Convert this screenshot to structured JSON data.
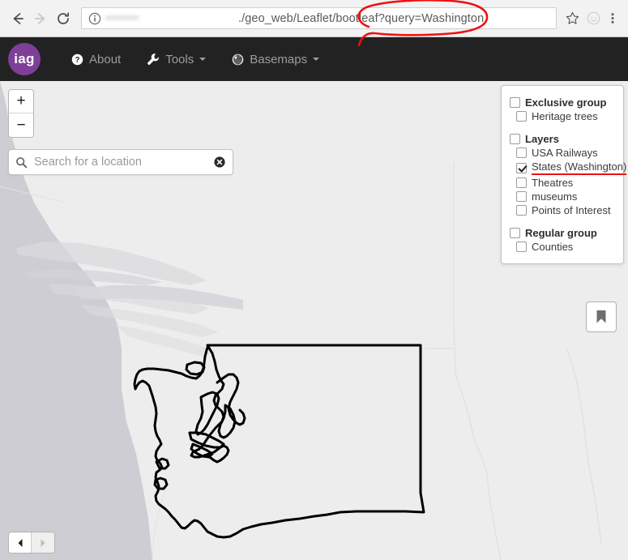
{
  "browser": {
    "back_label": "Back",
    "forward_label": "Forward",
    "reload_label": "Reload",
    "info_icon": "info-circle-icon",
    "url": {
      "origin_redacted": "••••••••",
      "separator": ".",
      "path": "/geo_web/Leaflet/bootleaf",
      "query": "?query=Washington",
      "full": "/geo_web/Leaflet/bootleaf/?query=Washington"
    },
    "star_label": "Bookmark this page",
    "profile_label": "Profile",
    "menu_label": "Customize and control"
  },
  "navbar": {
    "brand": "iag",
    "items": [
      {
        "label": "About",
        "icon": "question-circle-icon",
        "has_caret": false
      },
      {
        "label": "Tools",
        "icon": "wrench-icon",
        "has_caret": true
      },
      {
        "label": "Basemaps",
        "icon": "globe-icon",
        "has_caret": true
      }
    ]
  },
  "map": {
    "zoom_in_label": "+",
    "zoom_out_label": "−",
    "search": {
      "placeholder": "Search for a location",
      "value": "",
      "clear_label": "×"
    },
    "bookmark_label": "Bookmarks",
    "pager": {
      "prev_label": "◀",
      "next_label": "▶"
    },
    "colors": {
      "ocean": "#cdcdd3",
      "land": "#ededed",
      "outline": "#000000",
      "brand_purple": "#7e3f98",
      "annotation_red": "#ee1111"
    },
    "feature_label": "Washington State boundary"
  },
  "layers_panel": {
    "groups": [
      {
        "name": "Exclusive group",
        "checked": false,
        "highlight": false,
        "children": [
          {
            "name": "Heritage trees",
            "checked": false,
            "highlight": false
          }
        ]
      },
      {
        "name": "Layers",
        "checked": false,
        "highlight": false,
        "children": [
          {
            "name": "USA Railways",
            "checked": false,
            "highlight": false
          },
          {
            "name": "States (Washington)",
            "checked": true,
            "highlight": true
          },
          {
            "name": "Theatres",
            "checked": false,
            "highlight": false
          },
          {
            "name": "museums",
            "checked": false,
            "highlight": false
          },
          {
            "name": "Points of Interest",
            "checked": false,
            "highlight": false
          }
        ]
      },
      {
        "name": "Regular group",
        "checked": false,
        "highlight": false,
        "children": [
          {
            "name": "Counties",
            "checked": false,
            "highlight": false
          }
        ]
      }
    ]
  },
  "annotations": [
    {
      "type": "ellipse",
      "target": "url-query",
      "color": "#ee1111"
    },
    {
      "type": "underline",
      "target": "States (Washington)",
      "color": "#ee1111"
    }
  ]
}
